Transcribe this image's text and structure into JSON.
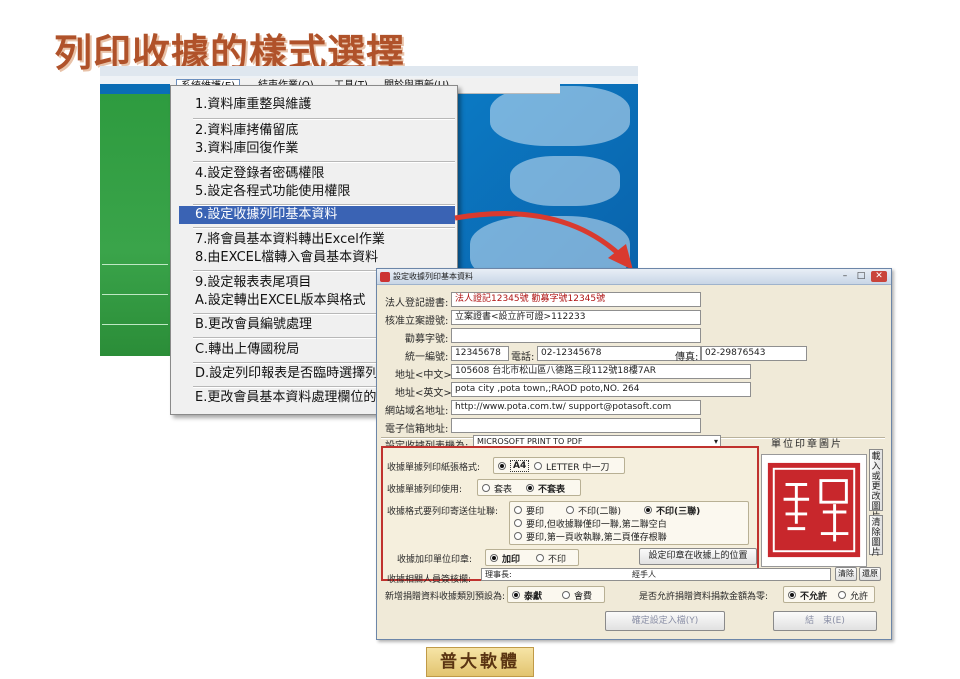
{
  "slide": {
    "title": "列印收據的樣式選擇",
    "logo_text": "普大軟體"
  },
  "app": {
    "menubar": [
      "系統維護(E)",
      "結束作業(Q)",
      "工具(T)",
      "關於與更新(U)"
    ]
  },
  "dropdown_items": [
    "1.資料庫重整與維護",
    "2.資料庫拷備留底",
    "3.資料庫回復作業",
    "4.設定登錄者密碼權限",
    "5.設定各程式功能使用權限",
    "6.設定收據列印基本資料",
    "7.將會員基本資料轉出Excel作業",
    "8.由EXCEL檔轉入會員基本資料",
    "9.設定報表表尾項目",
    "A.設定轉出EXCEL版本與格式",
    "B.更改會員編號處理",
    "C.轉出上傳國稅局",
    "D.設定列印報表是否臨時選擇列",
    "E.更改會員基本資料處理欄位的"
  ],
  "dialog": {
    "title": "設定收據列印基本資料",
    "fields": {
      "registration_label": "法人登記證書:",
      "registration_value": "法人證記12345號  勸募字號12345號",
      "approval_label": "核准立案證號:",
      "approval_value": "立案證書<設立許可證>112233",
      "fundraising_label": "勸募字號:",
      "fundraising_value": "",
      "tax_id_label": "統一編號:",
      "tax_id_value": "12345678",
      "phone_label": "電話:",
      "phone_value": "02-12345678",
      "fax_label": "傳真:",
      "fax_value": "02-29876543",
      "address_zh_label": "地址<中文>:",
      "address_zh_value": "105608 台北市松山區八德路三段112號18樓7AR",
      "address_en_label": "地址<英文>:",
      "address_en_value": "pota city ,pota town,;RAOD poto,NO. 264",
      "website_label": "網站域名地址:",
      "website_value": "http://www.pota.com.tw/ support@potasoft.com",
      "email_label": "電子信箱地址:",
      "email_value": ""
    },
    "printer_label": "設定收據列表機為:",
    "printer_value": "MICROSOFT PRINT TO PDF",
    "stamp_title": "單位印章圖片",
    "stamp_load_button": "載入或更改圖片",
    "stamp_clear_button": "清除圖片",
    "paper_format_label": "收據單據列印紙張格式:",
    "paper_a4": "A4",
    "paper_letter": "LETTER 中一刀",
    "use_label": "收據單據列印使用:",
    "use_opt1": "套表",
    "use_opt2": "不套表",
    "mail_label": "收據格式要列印寄送住址聯:",
    "mail_opt1": "要印",
    "mail_opt2": "不印(二聯)",
    "mail_opt3": "不印(三聯)",
    "mail_opt4": "要印,但收據聯僅印一聯,第二聯空白",
    "mail_opt5": "要印,第一頁收執聯,第二頁僅存根聯",
    "seal_label": "收據加印單位印章:",
    "seal_opt1": "加印",
    "seal_opt2": "不印",
    "seal_position_button": "設定印章在收據上的位置",
    "auditor_label": "收據相關人員簽核欄:",
    "auditor_value1": "理事長:",
    "auditor_value2": "經手人",
    "clear_button": "清除",
    "restore_button": "還原",
    "donation_type_label": "新增捐贈資料收據類別預設為:",
    "donation_opt1": "泰獻",
    "donation_opt2": "會費",
    "zero_label": "是否允許捐贈資料捐款金額為零:",
    "zero_opt1": "不允許",
    "zero_opt2": "允許",
    "confirm_button": "確定設定入檔(Y)",
    "close_button": "結　束(E)"
  },
  "colors": {
    "title": "#b0522a",
    "highlight": "#3a63b4",
    "red_box": "#c0322e",
    "arrow": "#d93a2f",
    "stamp": "#c8272c"
  }
}
